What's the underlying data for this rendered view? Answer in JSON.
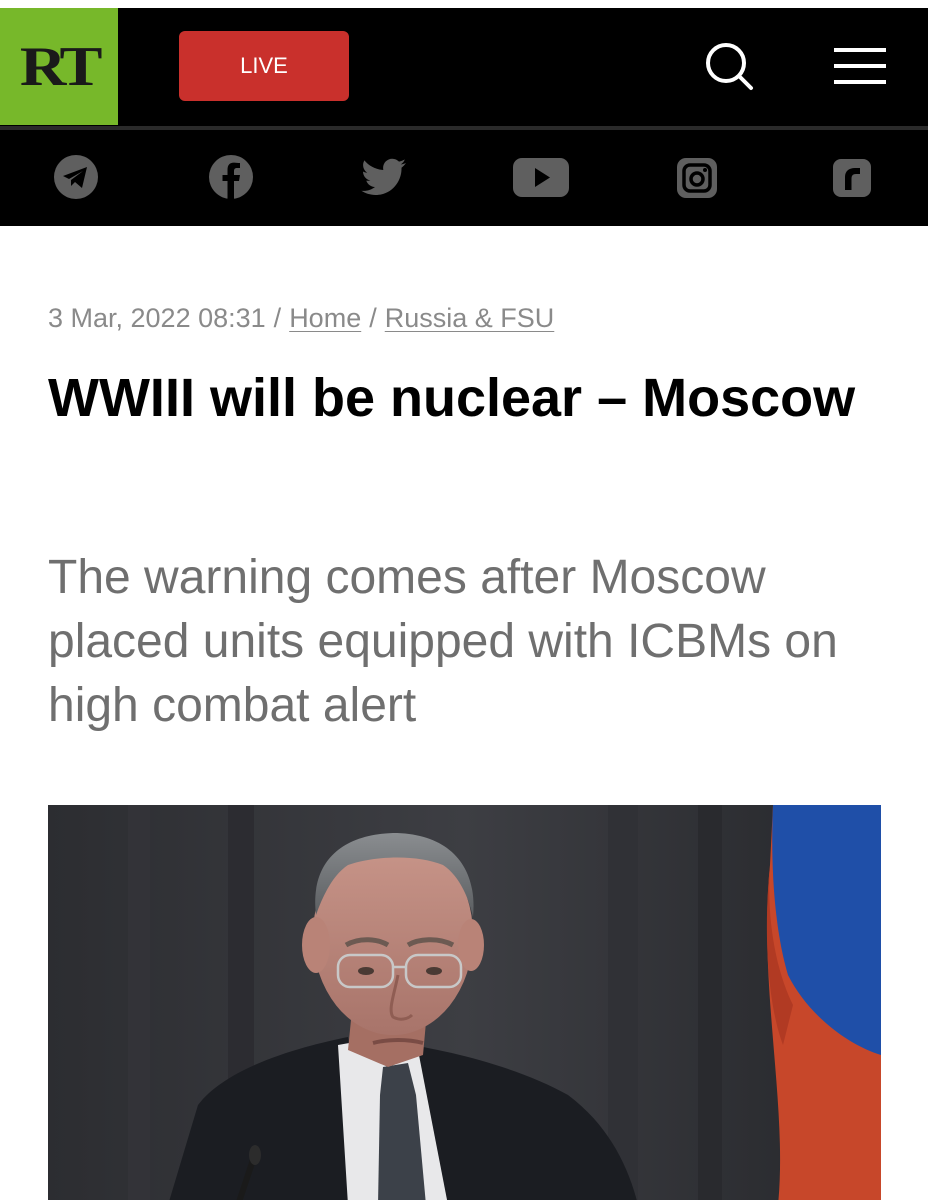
{
  "header": {
    "logo_text": "RT",
    "live_label": "LIVE",
    "search_icon": "search-icon",
    "menu_icon": "hamburger-menu-icon"
  },
  "social": {
    "icons": [
      "telegram-icon",
      "facebook-icon",
      "twitter-icon",
      "youtube-icon",
      "instagram-icon",
      "rumble-icon"
    ]
  },
  "article": {
    "date": "3 Mar, 2022 08:31",
    "separator": "/",
    "breadcrumbs": [
      "Home",
      "Russia & FSU"
    ],
    "title": "WWIII will be nuclear – Moscow",
    "subtitle": "The warning comes after Moscow placed units equipped with ICBMs on high combat alert"
  },
  "colors": {
    "brand_green": "#77b82a",
    "live_red": "#c9302c",
    "header_black": "#000000",
    "meta_gray": "#8a8a8a",
    "subtitle_gray": "#6f6f6f"
  }
}
